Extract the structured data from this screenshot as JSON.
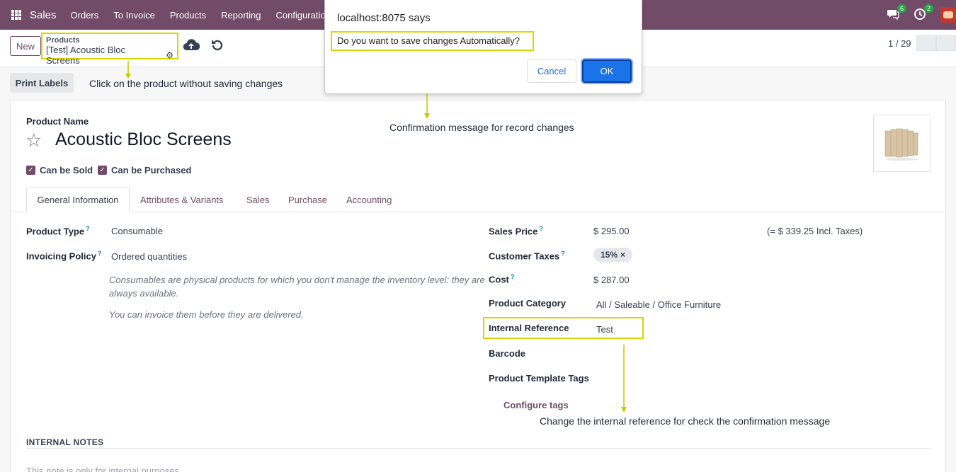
{
  "navbar": {
    "brand": "Sales",
    "items": [
      "Orders",
      "To Invoice",
      "Products",
      "Reporting",
      "Configuration"
    ],
    "messages_badge": "6",
    "activity_badge": "2",
    "bg_color": "#714b67"
  },
  "control": {
    "new_label": "New",
    "breadcrumb_parent": "Products",
    "breadcrumb_current": "[Test] Acoustic Bloc Screens",
    "pager": "1 / 29"
  },
  "actions": {
    "print_labels": "Print Labels"
  },
  "annotations": {
    "print_note": "Click on the product without saving changes",
    "confirm_note": "Confirmation message for record changes",
    "ref_note": "Change the internal reference for check the confirmation message",
    "highlight_color": "#d8d800"
  },
  "product": {
    "name_label": "Product Name",
    "name": "Acoustic Bloc Screens",
    "can_be_sold": "Can be Sold",
    "can_be_purchased": "Can be Purchased"
  },
  "tabs": [
    "General Information",
    "Attributes & Variants",
    "Sales",
    "Purchase",
    "Accounting"
  ],
  "left_fields": {
    "product_type_label": "Product Type",
    "product_type": "Consumable",
    "invoicing_policy_label": "Invoicing Policy",
    "invoicing_policy": "Ordered quantities",
    "help1_line1": "Consumables are physical products for which you don't manage the inventory level: they are",
    "help1_line2": "always available.",
    "help2": "You can invoice them before they are delivered."
  },
  "right_fields": {
    "sales_price_label": "Sales Price",
    "sales_price": "$ 295.00",
    "incl_taxes": "(= $ 339.25 Incl. Taxes)",
    "customer_taxes_label": "Customer Taxes",
    "customer_tax_tag": "15%",
    "cost_label": "Cost",
    "cost": "$ 287.00",
    "category_label": "Product Category",
    "category": "All / Saleable / Office Furniture",
    "internal_ref_label": "Internal Reference",
    "internal_ref": "Test",
    "barcode_label": "Barcode",
    "template_tags_label": "Product Template Tags",
    "configure_tags": "Configure tags"
  },
  "notes": {
    "title": "INTERNAL NOTES",
    "placeholder": "This note is only for internal purposes."
  },
  "dialog": {
    "title": "localhost:8075 says",
    "message": "Do you want to save changes Automatically?",
    "cancel": "Cancel",
    "ok": "OK"
  }
}
